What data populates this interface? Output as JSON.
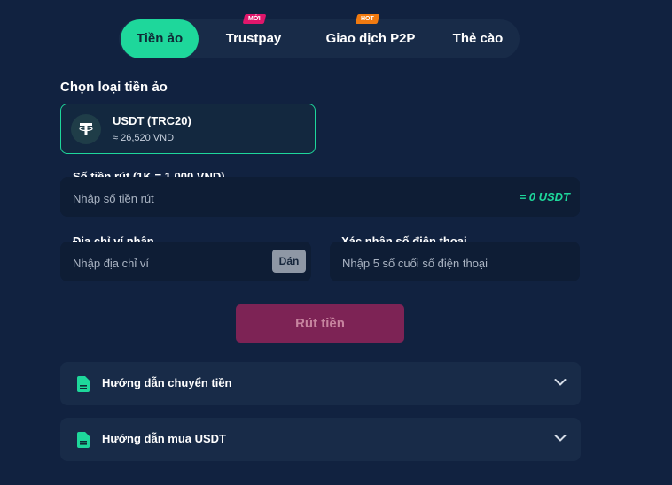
{
  "tabs": [
    {
      "label": "Tiền ảo",
      "active": true
    },
    {
      "label": "Trustpay",
      "badge": "MỚI",
      "badge_color": "#e0166b"
    },
    {
      "label": "Giao dịch P2P",
      "badge": "HOT",
      "badge_color": "#f07a10"
    },
    {
      "label": "Thẻ cào"
    }
  ],
  "crypto_section": {
    "title": "Chọn loại tiền ảo",
    "coin": {
      "name": "USDT (TRC20)",
      "rate": "≈ 26,520 VND",
      "icon": "tether-icon"
    }
  },
  "amount": {
    "label": "Số tiền rút (1K = 1,000 VND)",
    "placeholder": "Nhập số tiền rút",
    "value": "",
    "equivalent": "= 0 USDT"
  },
  "wallet": {
    "label": "Địa chỉ ví nhận",
    "placeholder": "Nhập địa chỉ ví",
    "value": "",
    "paste_label": "Dán"
  },
  "phone": {
    "label": "Xác nhận số điện thoại",
    "placeholder": "Nhập 5 số cuối số điện thoại",
    "value": ""
  },
  "withdraw_button": "Rút tiền",
  "guides": [
    {
      "label": "Hướng dẫn chuyển tiền",
      "icon": "document-icon"
    },
    {
      "label": "Hướng dẫn mua USDT",
      "icon": "document-icon"
    }
  ],
  "colors": {
    "accent": "#1ed79b",
    "background": "#112240",
    "button_disabled": "#7d2355"
  }
}
